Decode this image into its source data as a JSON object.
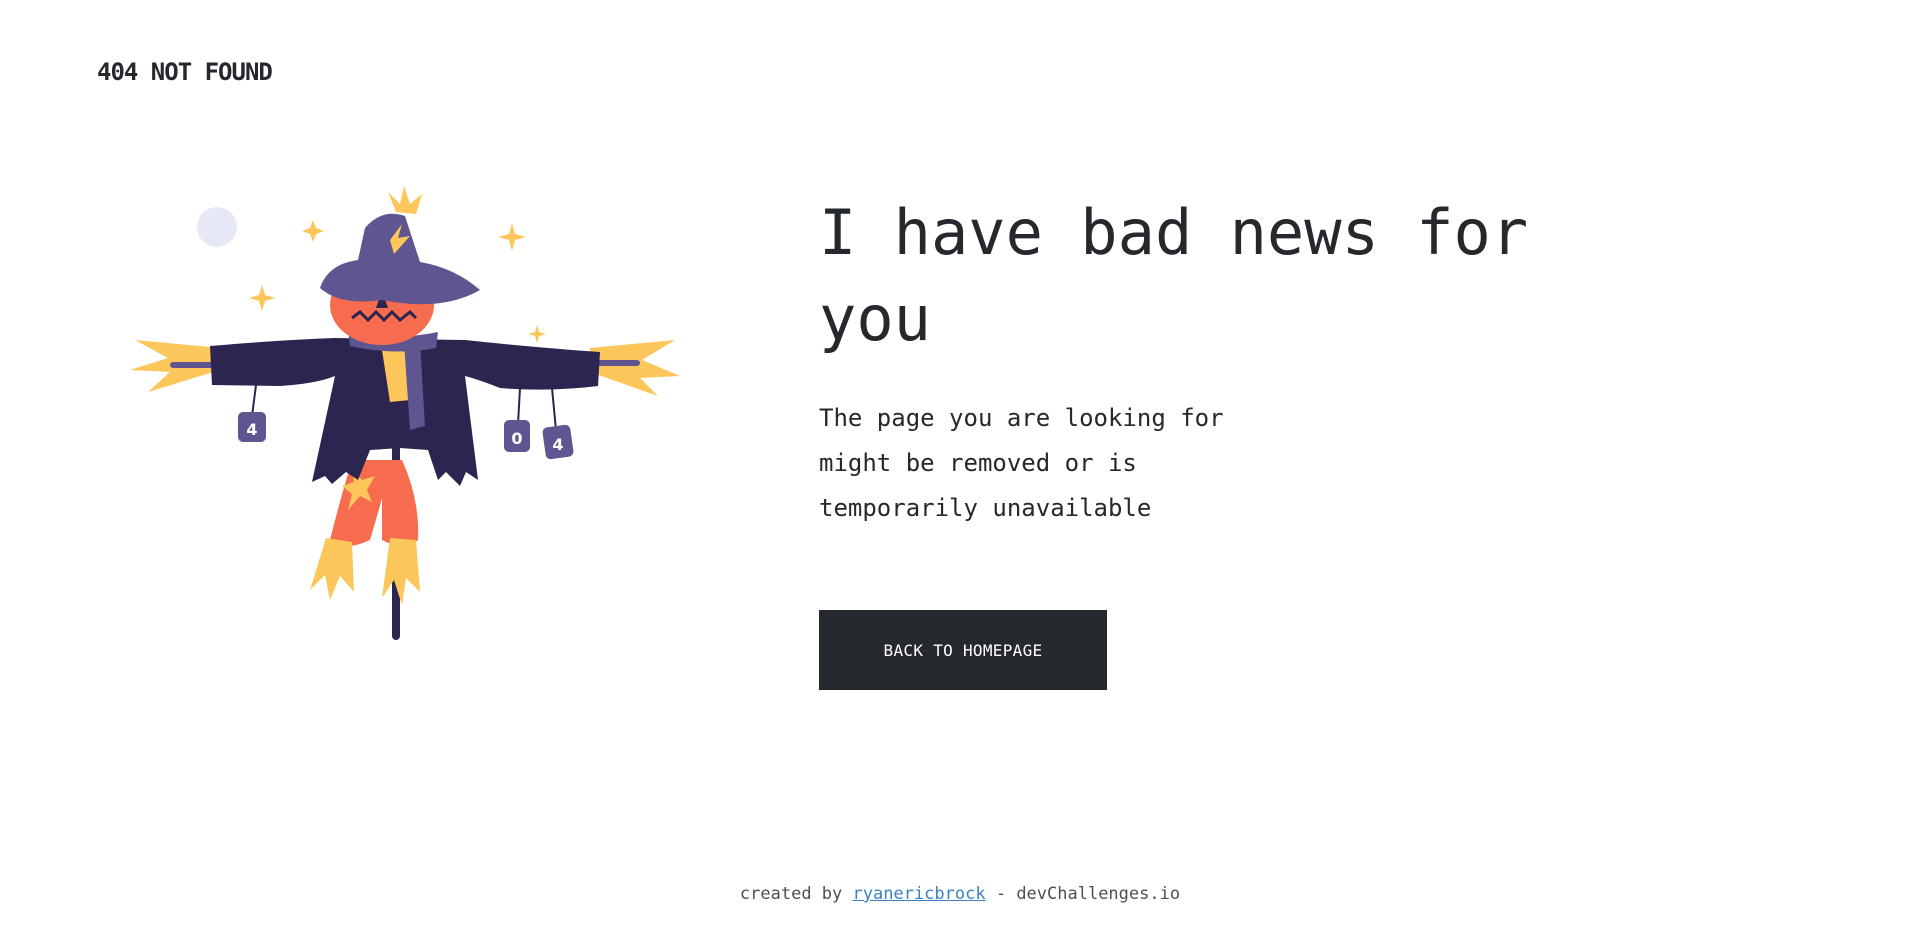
{
  "brand": {
    "label": "404 NOT FOUND"
  },
  "main": {
    "headline": "I have bad news for you",
    "message": "The page you are looking for might be removed or is temporarily unavailable",
    "cta_label": "BACK TO HOMEPAGE"
  },
  "illustration": {
    "can_labels": [
      "4",
      "0",
      "4"
    ],
    "colors": {
      "hat": "#5e5591",
      "coat": "#2b2550",
      "face": "#f76c4e",
      "straw": "#fdc65a",
      "moon": "#e6e9f5"
    }
  },
  "footer": {
    "prefix": "created by",
    "author": "ryanericbrock",
    "suffix": "- devChallenges.io"
  }
}
